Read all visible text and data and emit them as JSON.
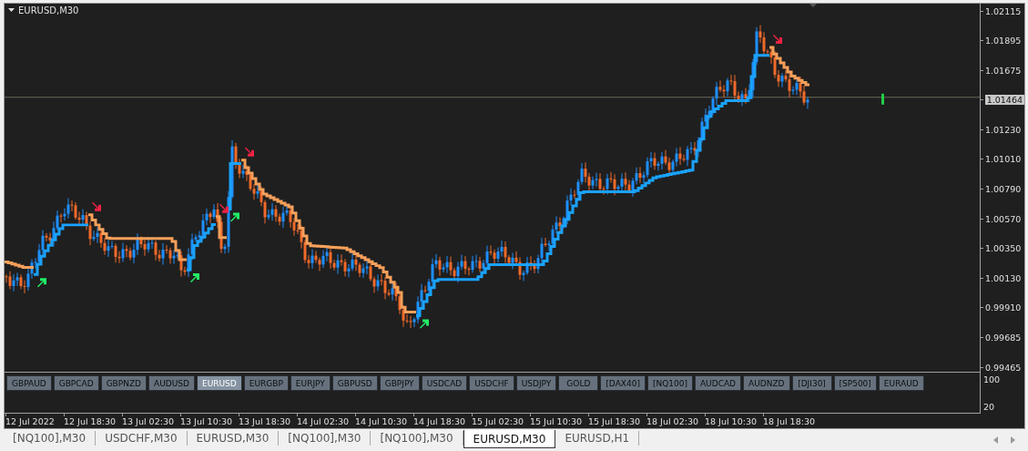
{
  "chart": {
    "title": "EURUSD,M30",
    "current_price": "1.01464"
  },
  "price_axis": [
    "1.02115",
    "1.01895",
    "1.01675",
    "1.01230",
    "1.01010",
    "1.00790",
    "1.00570",
    "1.00350",
    "1.00130",
    "0.99910",
    "0.99685",
    "0.99465"
  ],
  "symbol_buttons": [
    {
      "label": "GBPAUD",
      "selected": false
    },
    {
      "label": "GBPCAD",
      "selected": false
    },
    {
      "label": "GBPNZD",
      "selected": false
    },
    {
      "label": "AUDUSD",
      "selected": false
    },
    {
      "label": "EURUSD",
      "selected": true
    },
    {
      "label": "EURGBP",
      "selected": false
    },
    {
      "label": "EURJPY",
      "selected": false
    },
    {
      "label": "GBPUSD",
      "selected": false
    },
    {
      "label": "GBPJPY",
      "selected": false
    },
    {
      "label": "USDCAD",
      "selected": false
    },
    {
      "label": "USDCHF",
      "selected": false
    },
    {
      "label": "USDJPY",
      "selected": false
    },
    {
      "label": "GOLD",
      "selected": false
    },
    {
      "label": "[DAX40]",
      "selected": false
    },
    {
      "label": "[NQ100]",
      "selected": false
    },
    {
      "label": "AUDCAD",
      "selected": false
    },
    {
      "label": "AUDNZD",
      "selected": false
    },
    {
      "label": "[DJI30]",
      "selected": false
    },
    {
      "label": "[SP500]",
      "selected": false
    },
    {
      "label": "EURAUD",
      "selected": false
    }
  ],
  "subwindow_axis": [
    "100",
    "20"
  ],
  "time_axis": [
    "12 Jul 2022",
    "12 Jul 18:30",
    "13 Jul 02:30",
    "13 Jul 10:30",
    "13 Jul 18:30",
    "14 Jul 02:30",
    "14 Jul 10:30",
    "14 Jul 18:30",
    "15 Jul 02:30",
    "15 Jul 10:30",
    "15 Jul 18:30",
    "18 Jul 02:30",
    "18 Jul 10:30",
    "18 Jul 18:30"
  ],
  "tabs": [
    {
      "label": "[NQ100],M30",
      "selected": false
    },
    {
      "label": "USDCHF,M30",
      "selected": false
    },
    {
      "label": "EURUSD,M30",
      "selected": false
    },
    {
      "label": "[NQ100],M30",
      "selected": false
    },
    {
      "label": "[NQ100],M30",
      "selected": false
    },
    {
      "label": "EURUSD,M30",
      "selected": true
    },
    {
      "label": "EURUSD,H1",
      "selected": false
    }
  ]
}
